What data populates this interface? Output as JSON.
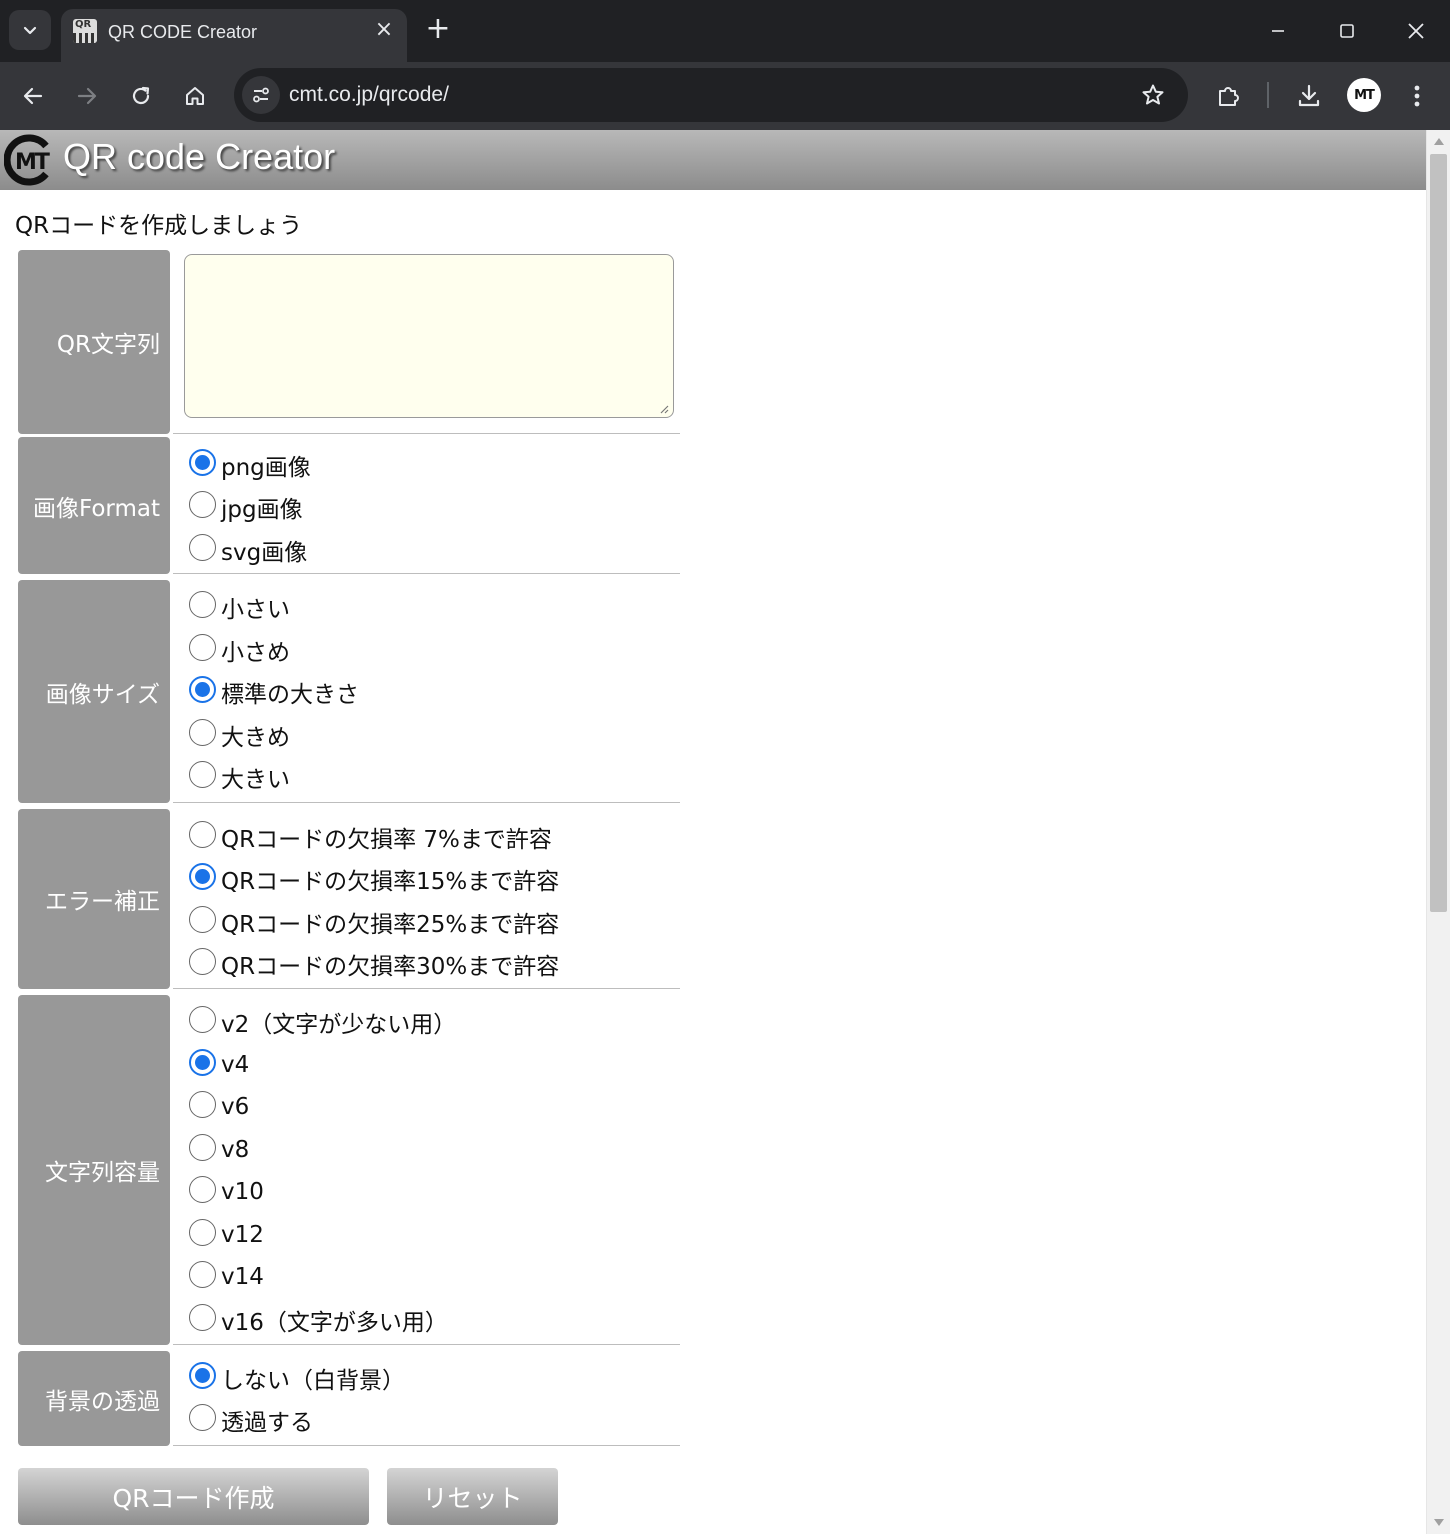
{
  "browser": {
    "tab_title": "QR CODE Creator",
    "url": "cmt.co.jp/qrcode/",
    "profile_initials": "MT"
  },
  "header": {
    "title": "QR code Creator",
    "logo_text": "MT"
  },
  "intro": "QRコードを作成しましょう",
  "form": {
    "qr_text": {
      "label": "QR文字列",
      "value": ""
    },
    "format": {
      "label": "画像Format",
      "options": [
        "png画像",
        "jpg画像",
        "svg画像"
      ],
      "selected": "png画像"
    },
    "size": {
      "label": "画像サイズ",
      "options": [
        "小さい",
        "小さめ",
        "標準の大きさ",
        "大きめ",
        "大きい"
      ],
      "selected": "標準の大きさ"
    },
    "error_correction": {
      "label": "エラー補正",
      "options": [
        "QRコードの欠損率 7%まで許容",
        "QRコードの欠損率15%まで許容",
        "QRコードの欠損率25%まで許容",
        "QRコードの欠損率30%まで許容"
      ],
      "selected": "QRコードの欠損率15%まで許容"
    },
    "capacity": {
      "label": "文字列容量",
      "options": [
        "v2（文字が少ない用）",
        "v4",
        "v6",
        "v8",
        "v10",
        "v12",
        "v14",
        "v16（文字が多い用）"
      ],
      "selected": "v4"
    },
    "transparency": {
      "label": "背景の透過",
      "options": [
        "しない（白背景）",
        "透過する"
      ],
      "selected": "しない（白背景）"
    }
  },
  "buttons": {
    "create": "QRコード作成",
    "reset": "リセット"
  },
  "colors": {
    "chrome_dark": "#202124",
    "chrome_toolbar": "#35363a",
    "label_bg": "#989898",
    "textarea_bg": "#ffffee",
    "radio_accent": "#1a73e8"
  }
}
